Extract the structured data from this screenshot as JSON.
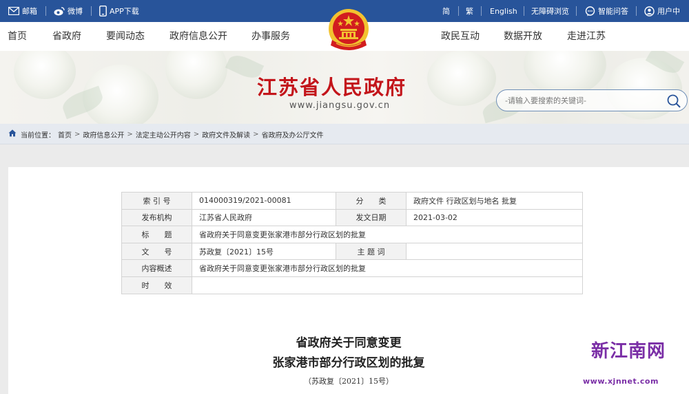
{
  "topbar": {
    "mail_label": "邮箱",
    "weibo_label": "微博",
    "app_label": "APP下载",
    "simplified_label": "简",
    "traditional_label": "繁",
    "english_label": "English",
    "accessible_label": "无障碍浏览",
    "smart_qa_label": "智能问答",
    "user_center_label": "用户中"
  },
  "nav": {
    "items_left": [
      "首页",
      "省政府",
      "要闻动态",
      "政府信息公开",
      "办事服务"
    ],
    "items_right": [
      "政民互动",
      "数据开放",
      "走进江苏"
    ]
  },
  "banner": {
    "site_title": "江苏省人民政府",
    "site_url": "www.jiangsu.gov.cn",
    "search_placeholder": "-请输入要搜索的关键词-"
  },
  "breadcrumb": {
    "lead": "当前位置：",
    "items": [
      "首页",
      "政府信息公开",
      "法定主动公开内容",
      "政府文件及解读",
      "省政府及办公厅文件"
    ]
  },
  "meta_table": {
    "index_key": "索 引 号",
    "index_value": "014000319/2021-00081",
    "category_key": "分　　类",
    "category_value": "政府文件 行政区划与地名 批复",
    "publisher_key": "发布机构",
    "publisher_value": "江苏省人民政府",
    "issue_date_key": "发文日期",
    "issue_date_value": "2021-03-02",
    "title_key": "标　　题",
    "title_value": "省政府关于同意变更张家港市部分行政区划的批复",
    "doc_no_key": "文　　号",
    "doc_no_value": "苏政复〔2021〕15号",
    "subject_key": "主 题 词",
    "subject_value": "",
    "summary_key": "内容概述",
    "summary_value": "省政府关于同意变更张家港市部分行政区划的批复",
    "validity_key": "时　　效",
    "validity_value": ""
  },
  "document": {
    "title_line1": "省政府关于同意变更",
    "title_line2": "张家港市部分行政区划的批复",
    "doc_number": "（苏政复〔2021〕15号）"
  },
  "watermark": {
    "site_name": "新江南网",
    "url": "www.xjnnet.com"
  },
  "colors": {
    "topbar_bg": "#28549a",
    "title_red": "#c3151b",
    "emblem_red": "#d21d1f",
    "emblem_gold": "#f2c230",
    "watermark_purple": "#7a2ea6"
  },
  "icons": [
    "mail-icon",
    "weibo-icon",
    "phone-icon",
    "chat-icon",
    "user-icon",
    "search-icon",
    "home-icon",
    "national-emblem"
  ]
}
